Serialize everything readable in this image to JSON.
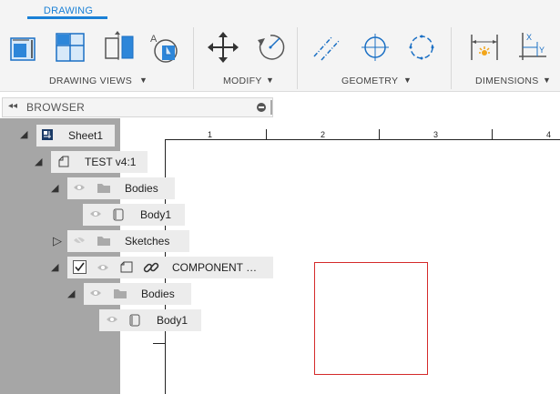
{
  "ribbon": {
    "active_tab": "DRAWING",
    "groups": [
      {
        "label": "DRAWING VIEWS"
      },
      {
        "label": "MODIFY"
      },
      {
        "label": "GEOMETRY"
      },
      {
        "label": "DIMENSIONS"
      }
    ],
    "icons": [
      "base-view-icon",
      "projected-view-icon",
      "section-view-icon",
      "detail-view-icon",
      "move-icon",
      "rotate-icon",
      "centerline-icon",
      "center-mark-icon",
      "center-mark-pattern-icon",
      "linear-dimension-icon",
      "ordinate-dimension-icon"
    ],
    "accent_color": "#1a80d6"
  },
  "browser": {
    "title": "BROWSER",
    "tree": [
      {
        "label": "Sheet1",
        "level": 0
      },
      {
        "label": "TEST v4:1",
        "level": 1
      },
      {
        "label": "Bodies",
        "level": 2
      },
      {
        "label": "Body1",
        "level": 3
      },
      {
        "label": "Sketches",
        "level": 2
      },
      {
        "label": "COMPONENT …",
        "level": 2
      },
      {
        "label": "Bodies",
        "level": 3
      },
      {
        "label": "Body1",
        "level": 4
      }
    ]
  },
  "drawing": {
    "ruler_numbers": [
      "1",
      "2",
      "3",
      "4"
    ],
    "view_frame_color": "#d42a2a"
  }
}
